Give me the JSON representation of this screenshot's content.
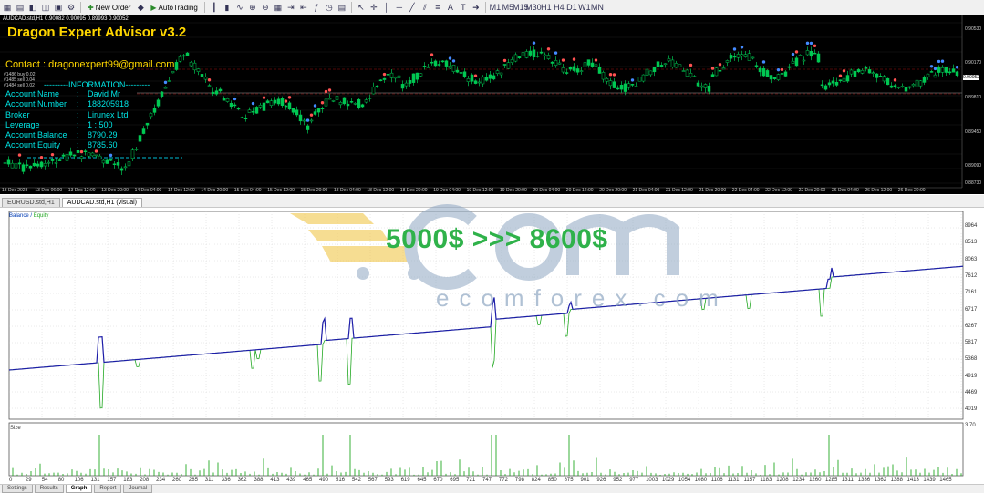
{
  "toolbar": {
    "new_order_label": "New Order",
    "autotrading_label": "AutoTrading"
  },
  "chart": {
    "title": "AUDCAD.std,H1  0.90082 0.90095 0.89993 0.90052",
    "ea_name": "Dragon Expert Advisor v3.2",
    "contact": "Contact : dragonexpert99@gmail.com",
    "order_lines": [
      "#1486 buy 0.02",
      "#1485 sell 0.04",
      "#1484 sell 0.02"
    ],
    "info_title": "INFORMATION",
    "info": [
      {
        "key": "Account Name",
        "value": "David Mr"
      },
      {
        "key": "Account Number",
        "value": "188205918"
      },
      {
        "key": "Broker",
        "value": "Lirunex Ltd"
      },
      {
        "key": "Leverage",
        "value": "1 : 500"
      },
      {
        "key": "Account Balance",
        "value": "8790.29"
      },
      {
        "key": "Account Equity",
        "value": "8785.60"
      }
    ],
    "price_labels": [
      "0.90530",
      "0.90170",
      "0.90052",
      "0.89810",
      "0.89450",
      "0.89090",
      "0.88730"
    ],
    "current_price": "0.90052",
    "time_labels": [
      "13 Dec 2023",
      "13 Dec 06:00",
      "13 Dec 12:00",
      "13 Dec 20:00",
      "14 Dec 04:00",
      "14 Dec 12:00",
      "14 Dec 20:00",
      "15 Dec 04:00",
      "15 Dec 12:00",
      "15 Dec 20:00",
      "18 Dec 04:00",
      "18 Dec 12:00",
      "18 Dec 20:00",
      "19 Dec 04:00",
      "19 Dec 12:00",
      "19 Dec 20:00",
      "20 Dec 04:00",
      "20 Dec 12:00",
      "20 Dec 20:00",
      "21 Dec 04:00",
      "21 Dec 12:00",
      "21 Dec 20:00",
      "22 Dec 04:00",
      "22 Dec 12:00",
      "22 Dec 20:00",
      "26 Dec 04:00",
      "26 Dec 12:00",
      "26 Dec 20:00"
    ]
  },
  "chart_tabs": [
    "EURUSD.std,H1",
    "AUDCAD.std,H1 (visual)"
  ],
  "graph": {
    "legend_balance": "Balance",
    "legend_sep": " / ",
    "legend_equity": "Equity",
    "banner": "5000$ >>> 8600$",
    "watermark_text": "ecomforex.com",
    "size_label": "Size",
    "size_max_label": "3.70",
    "y_labels": [
      "8964",
      "8513",
      "8063",
      "7612",
      "7161",
      "6717",
      "6267",
      "5817",
      "5368",
      "4919",
      "4469",
      "4019"
    ],
    "x_labels": [
      "0",
      "29",
      "54",
      "80",
      "106",
      "131",
      "157",
      "183",
      "208",
      "234",
      "260",
      "285",
      "311",
      "336",
      "362",
      "388",
      "413",
      "439",
      "465",
      "490",
      "516",
      "542",
      "567",
      "593",
      "619",
      "645",
      "670",
      "695",
      "721",
      "747",
      "772",
      "798",
      "824",
      "850",
      "875",
      "901",
      "926",
      "952",
      "977",
      "1003",
      "1029",
      "1054",
      "1080",
      "1106",
      "1131",
      "1157",
      "1183",
      "1208",
      "1234",
      "1260",
      "1285",
      "1311",
      "1336",
      "1362",
      "1388",
      "1413",
      "1439",
      "1465"
    ]
  },
  "bottom_tabs": [
    "Settings",
    "Results",
    "Graph",
    "Report",
    "Journal"
  ],
  "colors": {
    "balance": "#1c1ca8",
    "equity": "#22a822",
    "ea_text": "#ffd700",
    "info_text": "#00e5e5",
    "banner": "#2fb24a"
  }
}
